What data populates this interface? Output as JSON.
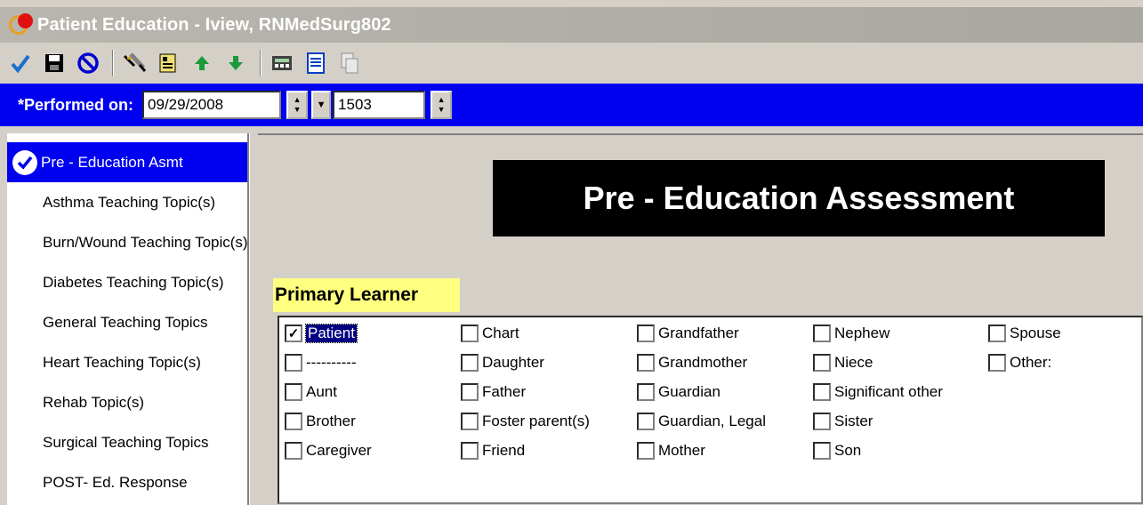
{
  "window": {
    "title": "Patient Education - Iview, RNMedSurg802"
  },
  "toolbar": {
    "buttons": [
      "sign-icon",
      "save-icon",
      "cancel-icon",
      "chart-icon",
      "reference-icon",
      "up-arrow-icon",
      "down-arrow-icon",
      "calculator-icon",
      "document-icon",
      "copy-icon"
    ],
    "colors": {
      "check": "#1a6fd0",
      "arrow": "#1a9a3a",
      "cancel": "#0000d0"
    }
  },
  "performed": {
    "label": "*Performed on:",
    "date": "09/29/2008",
    "time": "1503"
  },
  "nav": {
    "items": [
      {
        "label": "Pre - Education Asmt",
        "selected": true
      },
      {
        "label": "Asthma Teaching Topic(s)"
      },
      {
        "label": "Burn/Wound Teaching Topic(s)"
      },
      {
        "label": "Diabetes Teaching Topic(s)"
      },
      {
        "label": "General Teaching Topics"
      },
      {
        "label": "Heart Teaching Topic(s)"
      },
      {
        "label": "Rehab Topic(s)"
      },
      {
        "label": "Surgical Teaching Topics"
      },
      {
        "label": "POST- Ed. Response"
      }
    ]
  },
  "main": {
    "banner": "Pre - Education Assessment",
    "section": "Primary Learner",
    "options": [
      {
        "label": "Patient",
        "checked": true
      },
      {
        "label": "----------"
      },
      {
        "label": "Aunt"
      },
      {
        "label": "Brother"
      },
      {
        "label": "Caregiver"
      },
      {
        "label": "Chart"
      },
      {
        "label": "Daughter"
      },
      {
        "label": "Father"
      },
      {
        "label": "Foster parent(s)"
      },
      {
        "label": "Friend"
      },
      {
        "label": "Grandfather"
      },
      {
        "label": "Grandmother"
      },
      {
        "label": "Guardian"
      },
      {
        "label": "Guardian, Legal"
      },
      {
        "label": "Mother"
      },
      {
        "label": "Nephew"
      },
      {
        "label": "Niece"
      },
      {
        "label": "Significant other"
      },
      {
        "label": "Sister"
      },
      {
        "label": "Son"
      },
      {
        "label": "Spouse"
      },
      {
        "label": "Other:"
      }
    ]
  },
  "colors": {
    "banner_bg": "#000000",
    "perfbar_bg": "#0000f0",
    "section_bg": "#ffff80",
    "nav_selected": "#0000f0"
  }
}
